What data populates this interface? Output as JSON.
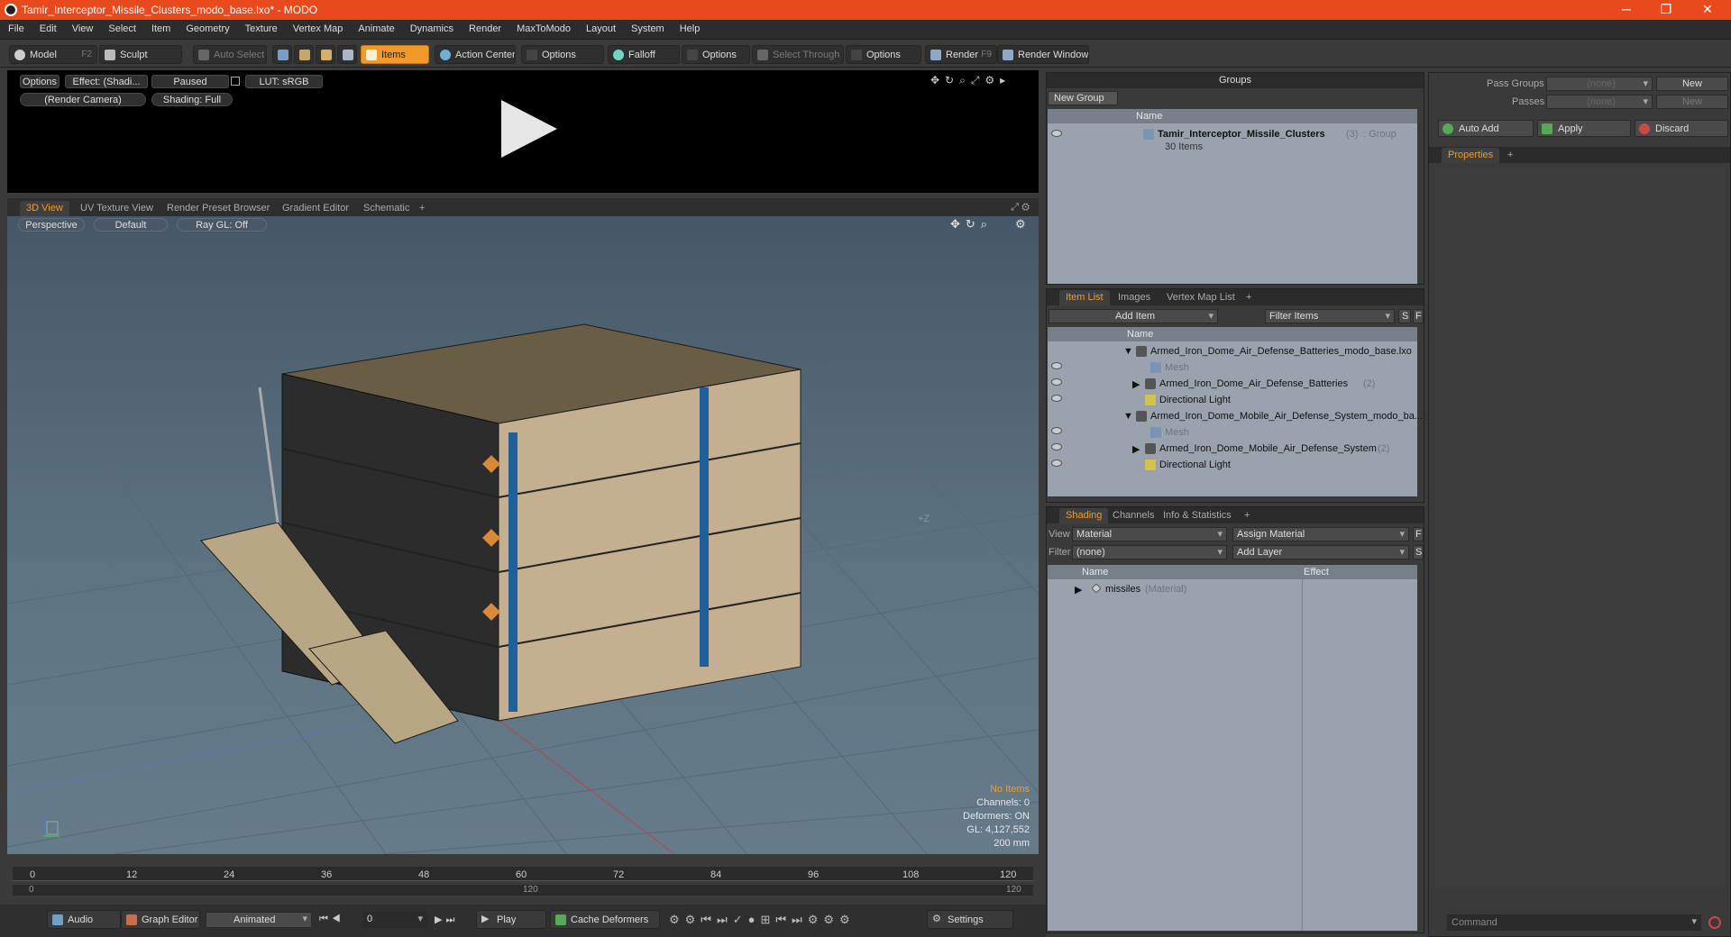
{
  "window": {
    "title": "Tamir_Interceptor_Missile_Clusters_modo_base.lxo* - MODO",
    "minimize": "─",
    "restore": "❐",
    "close": "✕"
  },
  "menu": [
    "File",
    "Edit",
    "View",
    "Select",
    "Item",
    "Geometry",
    "Texture",
    "Vertex Map",
    "Animate",
    "Dynamics",
    "Render",
    "MaxToModo",
    "Layout",
    "System",
    "Help"
  ],
  "toolbar": {
    "model": "Model",
    "model_key": "F2",
    "sculpt": "Sculpt",
    "auto_select": "Auto Select",
    "items": "Items",
    "action_center": "Action Center",
    "options1": "Options",
    "falloff": "Falloff",
    "options2": "Options",
    "select_through": "Select Through",
    "options3": "Options",
    "render": "Render",
    "render_key": "F9",
    "render_window": "Render Window"
  },
  "preview": {
    "options": "Options",
    "effect": "Effect: (Shadi...",
    "paused": "Paused",
    "lut": "LUT: sRGB",
    "camera": "(Render Camera)",
    "shading": "Shading: Full"
  },
  "viewport_tabs": [
    "3D View",
    "UV Texture View",
    "Render Preset Browser",
    "Gradient Editor",
    "Schematic",
    "+"
  ],
  "viewport": {
    "perspective": "Perspective",
    "default": "Default",
    "raygl": "Ray GL: Off",
    "axis_label": "+Z",
    "stats": {
      "no_items": "No Items",
      "channels": "Channels: 0",
      "deformers": "Deformers: ON",
      "gl": "GL: 4,127,552",
      "scale": "200 mm"
    }
  },
  "timeline": {
    "ticks": [
      "0",
      "12",
      "24",
      "36",
      "48",
      "60",
      "72",
      "84",
      "96",
      "108",
      "120"
    ],
    "lower": [
      "0",
      "120",
      "120"
    ]
  },
  "bottom": {
    "audio": "Audio",
    "graph_editor": "Graph Editor",
    "animated": "Animated",
    "frame": "0",
    "play": "Play",
    "cache": "Cache Deformers",
    "settings": "Settings"
  },
  "groups": {
    "title": "Groups",
    "new_group": "New Group",
    "col_name": "Name",
    "item_name": "Tamir_Interceptor_Missile_Clusters",
    "item_count": "(3)",
    "item_type": ": Group",
    "item_sub": "30 Items"
  },
  "item_list": {
    "tabs": [
      "Item List",
      "Images",
      "Vertex Map List",
      "+"
    ],
    "add_item": "Add Item",
    "filter": "Filter Items",
    "s": "S",
    "f": "F",
    "col_name": "Name",
    "rows": [
      {
        "label": "Armed_Iron_Dome_Air_Defense_Batteries_modo_base.lxo",
        "indent": 0,
        "dim": false,
        "count": ""
      },
      {
        "label": "Mesh",
        "indent": 2,
        "dim": true,
        "count": ""
      },
      {
        "label": "Armed_Iron_Dome_Air_Defense_Batteries",
        "indent": 1,
        "dim": false,
        "count": "(2)"
      },
      {
        "label": "Directional Light",
        "indent": 1,
        "dim": false,
        "count": ""
      },
      {
        "label": "Armed_Iron_Dome_Mobile_Air_Defense_System_modo_ba...",
        "indent": 0,
        "dim": false,
        "count": ""
      },
      {
        "label": "Mesh",
        "indent": 2,
        "dim": true,
        "count": ""
      },
      {
        "label": "Armed_Iron_Dome_Mobile_Air_Defense_System",
        "indent": 1,
        "dim": false,
        "count": "(2)"
      },
      {
        "label": "Directional Light",
        "indent": 1,
        "dim": false,
        "count": ""
      }
    ]
  },
  "shading": {
    "tabs": [
      "Shading",
      "Channels",
      "Info & Statistics",
      "+"
    ],
    "view_label": "View",
    "view_value": "Material",
    "assign": "Assign Material",
    "f": "F",
    "filter_label": "Filter",
    "filter_value": "(none)",
    "add_layer": "Add Layer",
    "s": "S",
    "col_name": "Name",
    "col_effect": "Effect",
    "row_name": "missiles",
    "row_type": "(Material)"
  },
  "right": {
    "pass_groups": "Pass Groups",
    "passes": "Passes",
    "none1": "(none)",
    "none2": "(none)",
    "new1": "New",
    "new2": "New",
    "auto_add": "Auto Add",
    "apply": "Apply",
    "discard": "Discard",
    "properties": "Properties",
    "plus": "+",
    "command": "Command"
  },
  "colors": {
    "accent": "#f19a2b",
    "titlebar": "#e8491d",
    "viewport": "#5f7584"
  }
}
